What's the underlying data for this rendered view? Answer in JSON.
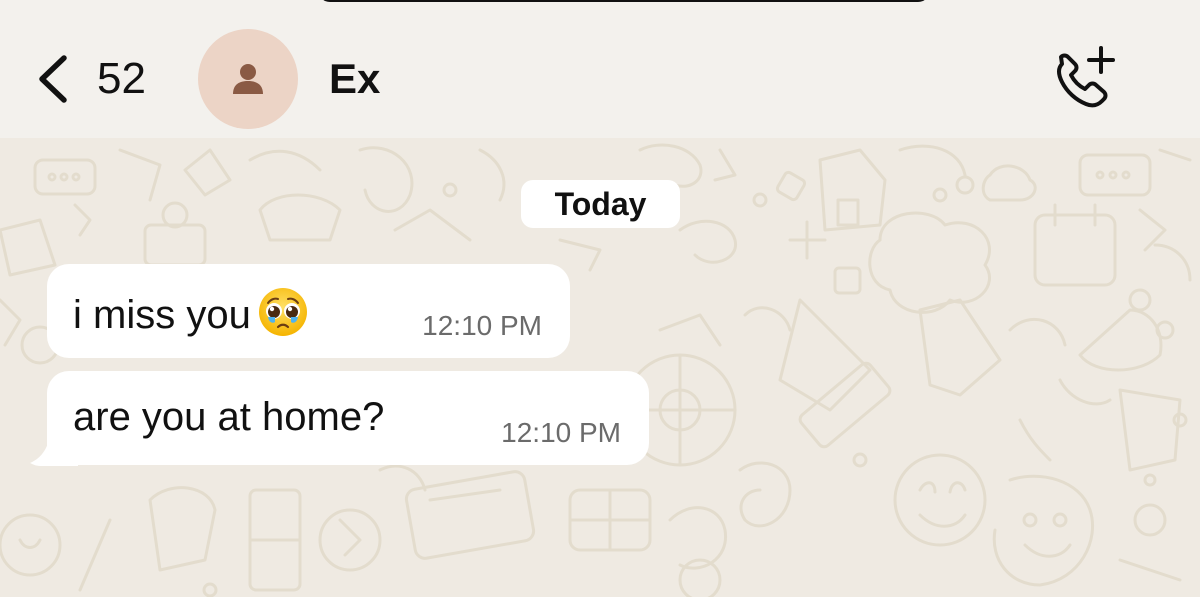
{
  "header": {
    "back_count": "52",
    "contact_name": "Ex",
    "avatar_icon": "person-icon",
    "call_icon": "add-call-icon"
  },
  "chat": {
    "date_label": "Today",
    "messages": [
      {
        "text": "i miss you",
        "emoji": "pleading-face-emoji",
        "time": "12:10 PM"
      },
      {
        "text": "are you at home?",
        "time": "12:10 PM"
      }
    ]
  },
  "colors": {
    "header_bg": "#f3f1ed",
    "wallpaper_bg": "#efeae2",
    "doodle": "#e3dccd",
    "bubble_bg": "#ffffff",
    "avatar_bg": "#ecd4c6",
    "avatar_icon": "#8a5a44"
  }
}
